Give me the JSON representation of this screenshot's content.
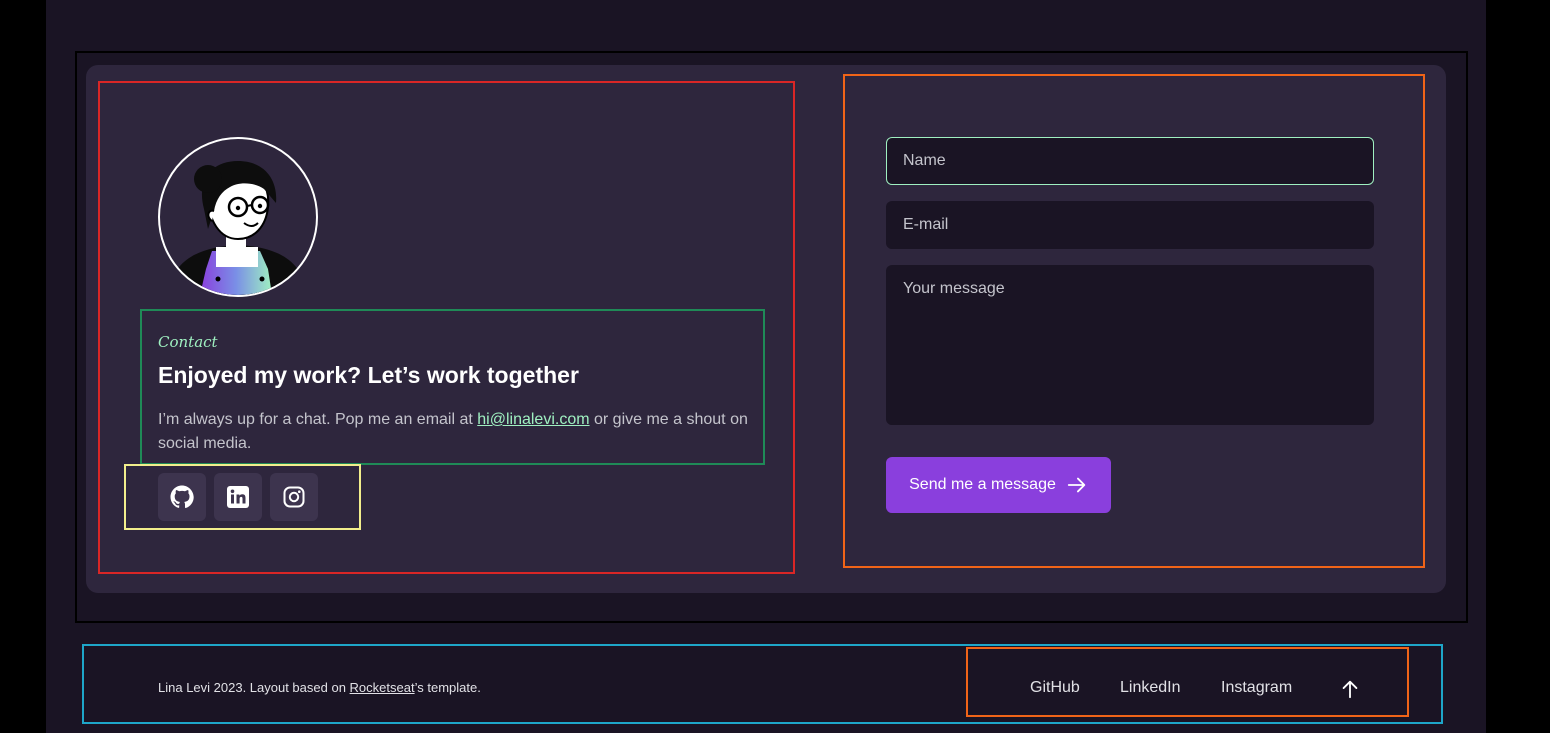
{
  "contact": {
    "label": "Contact",
    "heading": "Enjoyed my work? Let’s work together",
    "description_before": "I’m always up for a chat. Pop me an email at ",
    "email": "hi@linalevi.com",
    "description_after": " or give me a shout on social media."
  },
  "social": [
    {
      "icon": "github-icon"
    },
    {
      "icon": "linkedin-icon"
    },
    {
      "icon": "instagram-icon"
    }
  ],
  "form": {
    "name_placeholder": "Name",
    "email_placeholder": "E-mail",
    "message_placeholder": "Your message",
    "send_label": "Send me a message",
    "send_icon": "arrow-right-icon"
  },
  "footer": {
    "credit_before": "Lina Levi 2023. Layout based on ",
    "credit_link": "Rocketseat",
    "credit_after": "’s template.",
    "links": [
      "GitHub",
      "LinkedIn",
      "Instagram"
    ],
    "top_icon": "arrow-up-icon"
  },
  "colors": {
    "page_background": "#1a1424",
    "card_background": "#2e263d",
    "accent_green": "#9ff0c1",
    "button_purple": "#8a3fdd",
    "social_button": "#3d344e"
  }
}
